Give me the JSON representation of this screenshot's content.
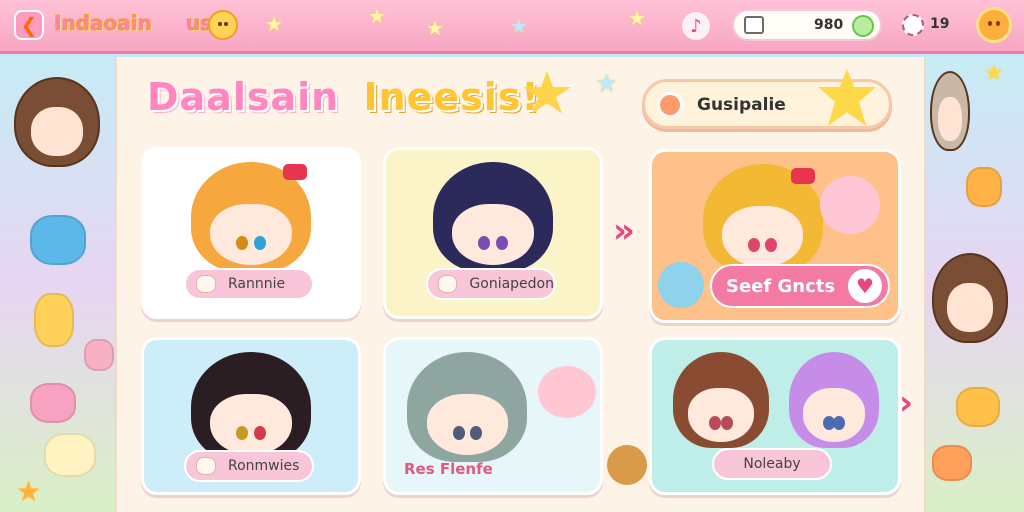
{
  "header": {
    "logo_text": "Indaoain",
    "logo_suffix": "us",
    "coins": "980",
    "gems": "19",
    "back_glyph": "❮",
    "music_glyph": "♪"
  },
  "page": {
    "title_part1": "Daalsain",
    "title_part2": "Ineesis!"
  },
  "filter": {
    "label": "Gusipalie"
  },
  "characters": [
    {
      "name": "Rannnie",
      "hair": "#f6a73e",
      "eye_l": "#d68a1a",
      "eye_r": "#2fa2d6",
      "bg": "#ffffff",
      "bow": true
    },
    {
      "name": "Goniapedon",
      "hair": "#2b2a5a",
      "eye_l": "#7b4db3",
      "eye_r": "#7b4db3",
      "bg": "#fbf4c9",
      "bow": false
    },
    {
      "name": "Seef Gncts",
      "hair": "#f4b934",
      "eye_l": "#e0466b",
      "eye_r": "#e0466b",
      "bg": "#ffc18a",
      "bow": true,
      "selected": true
    },
    {
      "name": "Ronmwies",
      "hair": "#2a1e22",
      "eye_l": "#c59b26",
      "eye_r": "#d23a4e",
      "bg": "#cdeef9",
      "bow": false
    },
    {
      "name": "Res Flenfe",
      "hair": "#8fa6a0",
      "eye_l": "#4d5d7a",
      "eye_r": "#4d5d7a",
      "bg": "#e6f6f9",
      "bow": false
    },
    {
      "name": "Noleaby",
      "hair": "#8a4b33",
      "eye_l": "#b84a5e",
      "eye_r": "#b84a5e",
      "bg": "#bfeee8",
      "bow": false
    }
  ],
  "arrows": {
    "next_glyph": "›"
  },
  "heart_glyph": "♥",
  "colors": {
    "accent_pink": "#f37aa4",
    "topbar": "#f7a6c3",
    "panel": "#fdf3e6"
  }
}
